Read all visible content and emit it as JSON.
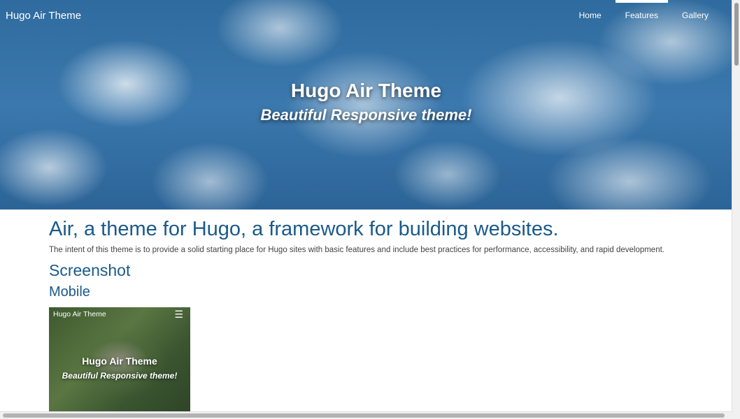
{
  "nav": {
    "brand": "Hugo Air Theme",
    "items": [
      {
        "label": "Home",
        "active": false
      },
      {
        "label": "Features",
        "active": true
      },
      {
        "label": "Gallery",
        "active": false
      }
    ]
  },
  "hero": {
    "title": "Hugo Air Theme",
    "subtitle": "Beautiful Responsive theme!"
  },
  "main": {
    "heading": "Air, a theme for Hugo, a framework for building websites.",
    "intro": "The intent of this theme is to provide a solid starting place for Hugo sites with basic features and include best practices for performance, accessibility, and rapid development.",
    "section_title": "Screenshot",
    "subsection_title": "Mobile"
  },
  "mobile_screenshot": {
    "brand": "Hugo Air Theme",
    "menu_icon": "hamburger-icon",
    "title": "Hugo Air Theme",
    "subtitle": "Beautiful Responsive theme!"
  },
  "colors": {
    "heading": "#1a5a8a",
    "hero_sky": "#3b78ad"
  }
}
